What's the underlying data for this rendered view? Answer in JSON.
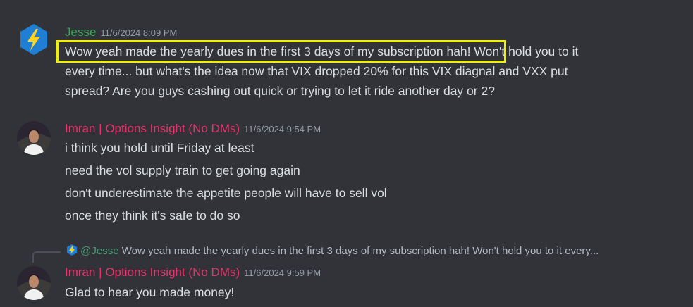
{
  "messages": [
    {
      "author": "Jesse",
      "author_color": "#3ba55c",
      "timestamp": "11/6/2024 8:09 PM",
      "highlighted_text": "Wow yeah made the yearly dues in the first 3 days of my subscription hah!",
      "line1_rest": " Won't hold you to it",
      "line2": "every time... but what's the idea now that VIX dropped 20% for this VIX diagnal and VXX put",
      "line3": "spread? Are you guys cashing out quick or trying to let it ride another day or 2?"
    },
    {
      "author": "Imran | Options Insight (No DMs)",
      "author_color": "#e8336b",
      "timestamp": "11/6/2024 9:54 PM",
      "lines": [
        "i think you hold until Friday at least",
        "need the vol supply train to get going again",
        "don't underestimate the appetite people will have to sell vol",
        "once they think it's safe to do so"
      ]
    },
    {
      "reply": {
        "mention": "@Jesse",
        "preview": "Wow yeah made the yearly dues in the first 3 days of my subscription hah! Won't hold you to it every..."
      },
      "author": "Imran | Options Insight (No DMs)",
      "author_color": "#e8336b",
      "timestamp": "11/6/2024 9:59 PM",
      "text": "Glad to hear you made money!"
    }
  ]
}
